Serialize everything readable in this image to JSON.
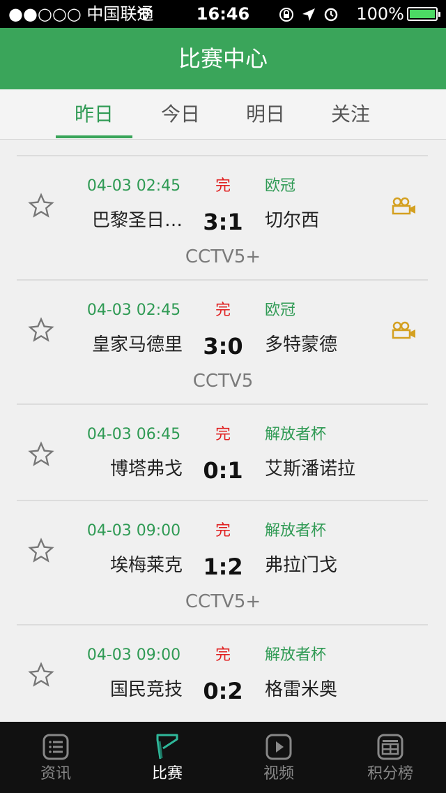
{
  "status_bar": {
    "signal": "●●○○○ 中国联通",
    "time": "16:46",
    "battery": "100%"
  },
  "nav": {
    "title": "比赛中心"
  },
  "day_tabs": [
    {
      "label": "昨日",
      "active": true
    },
    {
      "label": "今日",
      "active": false
    },
    {
      "label": "明日",
      "active": false
    },
    {
      "label": "关注",
      "active": false
    }
  ],
  "matches": [
    {
      "time": "04-03 02:45",
      "status": "完",
      "league": "欧冠",
      "home": "巴黎圣日…",
      "score": "3:1",
      "away": "切尔西",
      "tv": "CCTV5+",
      "has_video": true
    },
    {
      "time": "04-03 02:45",
      "status": "完",
      "league": "欧冠",
      "home": "皇家马德里",
      "score": "3:0",
      "away": "多特蒙德",
      "tv": "CCTV5",
      "has_video": true
    },
    {
      "time": "04-03 06:45",
      "status": "完",
      "league": "解放者杯",
      "home": "博塔弗戈",
      "score": "0:1",
      "away": "艾斯潘诺拉",
      "tv": "",
      "has_video": false
    },
    {
      "time": "04-03 09:00",
      "status": "完",
      "league": "解放者杯",
      "home": "埃梅莱克",
      "score": "1:2",
      "away": "弗拉门戈",
      "tv": "CCTV5+",
      "has_video": false
    },
    {
      "time": "04-03 09:00",
      "status": "完",
      "league": "解放者杯",
      "home": "国民竞技",
      "score": "0:2",
      "away": "格雷米奥",
      "tv": "",
      "has_video": false
    }
  ],
  "tab_bar": [
    {
      "label": "资讯",
      "icon": "news-icon",
      "active": false
    },
    {
      "label": "比赛",
      "icon": "match-icon",
      "active": true
    },
    {
      "label": "视频",
      "icon": "video-play-icon",
      "active": false
    },
    {
      "label": "积分榜",
      "icon": "standings-icon",
      "active": false
    }
  ],
  "colors": {
    "accent": "#3aa55a",
    "status_red": "#e02020",
    "tv_grey": "#7a7a7a",
    "video_icon": "#d4a020"
  }
}
